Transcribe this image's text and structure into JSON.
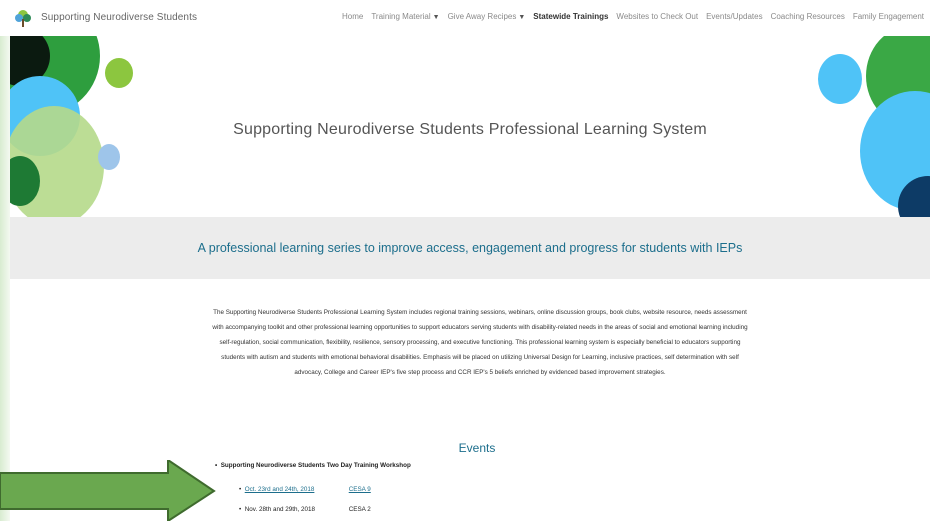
{
  "header": {
    "site_name": "Supporting Neurodiverse Students",
    "nav": [
      {
        "label": "Home",
        "dropdown": false,
        "active": false
      },
      {
        "label": "Training Material",
        "dropdown": true,
        "active": false
      },
      {
        "label": "Give Away Recipes",
        "dropdown": true,
        "active": false
      },
      {
        "label": "Statewide Trainings",
        "dropdown": false,
        "active": true
      },
      {
        "label": "Websites to Check Out",
        "dropdown": false,
        "active": false
      },
      {
        "label": "Events/Updates",
        "dropdown": false,
        "active": false
      },
      {
        "label": "Coaching Resources",
        "dropdown": false,
        "active": false
      },
      {
        "label": "Family Engagement",
        "dropdown": false,
        "active": false
      }
    ]
  },
  "hero": {
    "title": "Supporting Neurodiverse Students Professional Learning System"
  },
  "band": {
    "text": "A professional learning series to improve access, engagement and progress for students with IEPs"
  },
  "description": "The Supporting Neurodiverse Students Professional Learning System includes regional training sessions, webinars, online discussion groups, book clubs, website resource, needs assessment with accompanying toolkit and other professional learning opportunities to support educators serving students with disability-related needs in the areas of social and emotional learning including self-regulation, social communication, flexibility, resilience, sensory processing, and executive functioning. This professional learning system is especially beneficial to educators supporting students with autism and students with emotional behavioral disabilities. Emphasis will be placed on utilizing Universal Design for Learning, inclusive practices, self determination with self advocacy, College and Career IEP's five step process and CCR IEP's 5 beliefs enriched by evidenced based improvement strategies.",
  "events": {
    "heading": "Events",
    "item_title": "Supporting Neurodiverse Students Two Day Training Workshop",
    "sessions": [
      {
        "date": "Oct. 23rd and 24th, 2018",
        "location": "CESA 9",
        "linked": true
      },
      {
        "date": "Nov. 28th and 29th, 2018",
        "location": "CESA 2",
        "linked": false
      }
    ]
  },
  "colors": {
    "accent_teal": "#1c6e8c",
    "band_gray": "#ececec",
    "arrow_green": "#6aa84f",
    "circle_green": "#8cc63f",
    "circle_blue": "#4fc3f7",
    "circle_navy": "#0d3b66"
  },
  "icons": {
    "logo": "tree-logo-icon",
    "dropdown": "chevron-down-icon",
    "arrow": "arrow-right-icon"
  }
}
